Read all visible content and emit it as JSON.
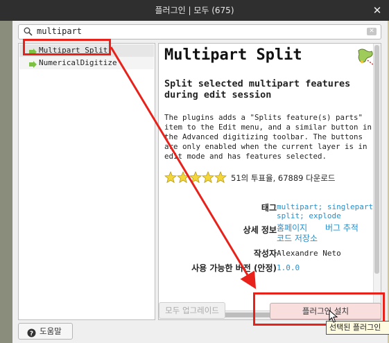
{
  "window": {
    "title": "플러그인 | 모두 (675)"
  },
  "search": {
    "value": "multipart"
  },
  "plugins": [
    {
      "label": "Multipart Split",
      "selected": true
    },
    {
      "label": "NumericalDigitize",
      "selected": false
    }
  ],
  "detail": {
    "title": "Multipart Split",
    "subtitle": "Split selected multipart features during edit session",
    "description": "The plugins adds a \"Splits feature(s) parts\" item to the Edit menu, and a similar button in the Advanced digitizing toolbar. The buttons are only enabled when the current layer is in edit mode and has features selected.",
    "rating": {
      "stars": 5,
      "votes_text": "51의 투표율, 67889 다운로드"
    },
    "tags_label": "태그",
    "tags_line1": "multipart; singlepart;",
    "tags_line2": "split; explode",
    "more_info_label": "상세 정보",
    "homepage_link": "홈페이지",
    "bug_tracker_link": "버그 추적",
    "code_repo_link": "코드 저장소",
    "author_label": "작성자",
    "author_value": "Alexandre Neto",
    "available_version_label": "사용 가능한 버전 (안정)",
    "available_version_value": "1.0.0"
  },
  "buttons": {
    "upgrade_all": "모두 업그레이드",
    "install": "플러그인 설치",
    "help": "도움말"
  },
  "tooltip": "선택된 플러그인",
  "colors": {
    "link": "#2a8ec9",
    "highlight": "#e8211a",
    "titlebar": "#2f2f2f",
    "plugin_icon": "#7dc142"
  }
}
